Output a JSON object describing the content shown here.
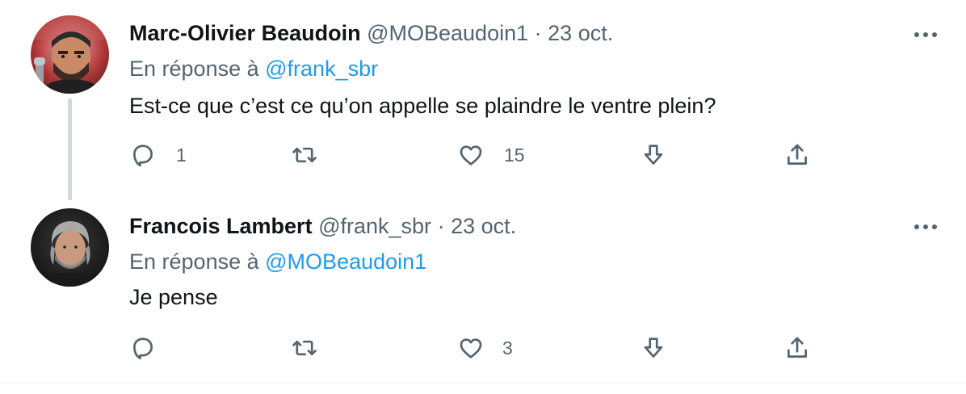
{
  "tweets": [
    {
      "author_name": "Marc-Olivier Beaudoin",
      "handle": "@MOBeaudoin1",
      "separator": "·",
      "date": "23 oct.",
      "reply_prefix": "En réponse à",
      "reply_mention": "@frank_sbr",
      "text": "Est-ce que c’est ce qu’on appelle se plaindre le ventre plein?",
      "reply_count": "1",
      "retweet_count": "",
      "like_count": "15"
    },
    {
      "author_name": "Francois Lambert",
      "handle": "@frank_sbr",
      "separator": "·",
      "date": "23 oct.",
      "reply_prefix": "En réponse à",
      "reply_mention": "@MOBeaudoin1",
      "text": "Je pense",
      "reply_count": "",
      "retweet_count": "",
      "like_count": "3"
    }
  ],
  "icons": {
    "more": "more-horizontal-icon",
    "reply": "reply-bubble-icon",
    "retweet": "retweet-icon",
    "like": "heart-icon",
    "downvote": "downvote-arrow-icon",
    "share": "share-upload-icon"
  },
  "colors": {
    "text": "#0f1419",
    "secondary": "#536471",
    "link": "#1d9bf0",
    "thread_line": "#cfd9de"
  }
}
